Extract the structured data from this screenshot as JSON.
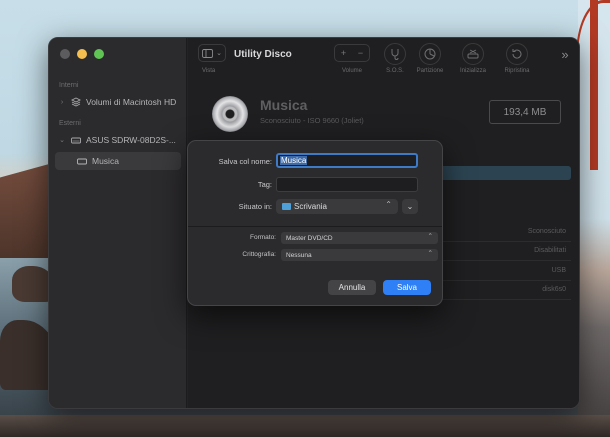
{
  "window": {
    "title": "Utility Disco"
  },
  "toolbar": {
    "view_label": "Vista",
    "volume_label": "Volume",
    "volume_add": "+",
    "volume_remove": "−",
    "sos_label": "S.O.S.",
    "partition_label": "Partizione",
    "erase_label": "Inizializza",
    "restore_label": "Ripristina",
    "more_symbol": "»"
  },
  "sidebar": {
    "section_internal": "Interni",
    "section_external": "Esterni",
    "items": [
      {
        "label": "Volumi di Macintosh HD",
        "icon": "stack-icon"
      },
      {
        "label": "ASUS SDRW-08D2S-...",
        "icon": "drive-icon"
      },
      {
        "label": "Musica",
        "icon": "disc-icon"
      }
    ]
  },
  "disk": {
    "name": "Musica",
    "subtitle": "Sconosciuto - ISO 9660 (Joliet)",
    "size": "193,4 MB",
    "info_values": [
      "Sconosciuto",
      "Disabilitati",
      "USB",
      "disk6s0"
    ]
  },
  "save_sheet": {
    "name_label": "Salva col nome:",
    "name_value": "Musica",
    "tags_label": "Tag:",
    "location_label": "Situato in:",
    "location_value": "Scrivania",
    "format_label": "Formato:",
    "format_value": "Master DVD/CD",
    "encryption_label": "Crittografia:",
    "encryption_value": "Nessuna",
    "cancel_label": "Annulla",
    "save_label": "Salva"
  },
  "colors": {
    "accent": "#2f7ff6",
    "window_bg": "#232325",
    "sheet_bg": "#2b2a2d"
  }
}
